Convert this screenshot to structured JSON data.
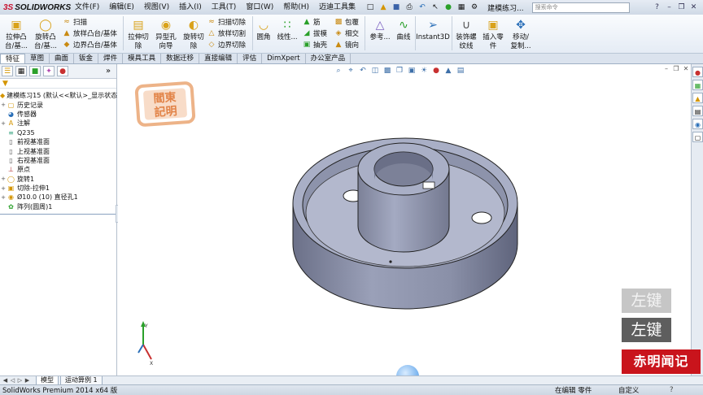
{
  "app": {
    "brand_ds": "3S",
    "brand_name": "SOLIDWORKS"
  },
  "menu": [
    "文件(F)",
    "编辑(E)",
    "视图(V)",
    "插入(I)",
    "工具(T)",
    "窗口(W)",
    "帮助(H)",
    "迈迪工具集"
  ],
  "document_title": "建模练习...",
  "search_placeholder": "搜索命令",
  "ribbon": {
    "big": [
      {
        "label1": "拉伸凸",
        "label2": "台/基..."
      },
      {
        "label1": "旋转凸",
        "label2": "台/基..."
      },
      {
        "label1": "拉伸切",
        "label2": "除"
      },
      {
        "label1": "异型孔",
        "label2": "向导"
      },
      {
        "label1": "旋转切",
        "label2": "除"
      },
      {
        "label1": "圆角",
        "label2": ""
      },
      {
        "label1": "线性...",
        "label2": ""
      },
      {
        "label1": "参考...",
        "label2": ""
      },
      {
        "label1": "曲线",
        "label2": ""
      },
      {
        "label1": "Instant3D",
        "label2": ""
      },
      {
        "label1": "装饰螺",
        "label2": "纹线"
      },
      {
        "label1": "插入零",
        "label2": "件"
      },
      {
        "label1": "移动/",
        "label2": "复制..."
      }
    ],
    "small": [
      "扫描",
      "放样凸台/基体",
      "边界凸台/基体",
      "扫描切除",
      "放样切割",
      "边界切除",
      "筋",
      "拔模",
      "抽壳",
      "包覆",
      "相交",
      "镜向"
    ]
  },
  "tabs": [
    "特征",
    "草图",
    "曲面",
    "钣金",
    "焊件",
    "模具工具",
    "数据迁移",
    "直接编辑",
    "评估",
    "DimXpert",
    "办公室产品"
  ],
  "tree": [
    {
      "label": "建模练习15  (默认<<默认>_显示状态",
      "kind": "root"
    },
    {
      "label": "历史记录",
      "kind": "item"
    },
    {
      "label": "传感器",
      "kind": "item"
    },
    {
      "label": "注解",
      "kind": "item"
    },
    {
      "label": "Q235",
      "kind": "item"
    },
    {
      "label": "前视基准面",
      "kind": "item"
    },
    {
      "label": "上视基准面",
      "kind": "item"
    },
    {
      "label": "右视基准面",
      "kind": "item"
    },
    {
      "label": "原点",
      "kind": "item"
    },
    {
      "label": "旋转1",
      "kind": "item"
    },
    {
      "label": "切除-拉伸1",
      "kind": "item"
    },
    {
      "label": "Ø10.0 (10) 直径孔1",
      "kind": "item"
    },
    {
      "label": "阵列(圆周)1",
      "kind": "item"
    }
  ],
  "stamp_text": "阎东记明",
  "bottom_tabs": [
    "模型",
    "运动算例 1"
  ],
  "status": {
    "product": "SolidWorks Premium 2014 x64 版",
    "editing": "在编辑 零件",
    "custom": "自定义",
    "help": "?"
  },
  "overlay": {
    "key1": "左键",
    "key2": "左键",
    "watermark": "赤明闻记"
  },
  "triad": {
    "y": "Y",
    "x": "X"
  },
  "colors": {
    "model_fill": "#9aa0b8",
    "model_dark": "#6b7088",
    "ribbon_bg": "#e5ecf5",
    "watermark_red": "#c9141c"
  }
}
